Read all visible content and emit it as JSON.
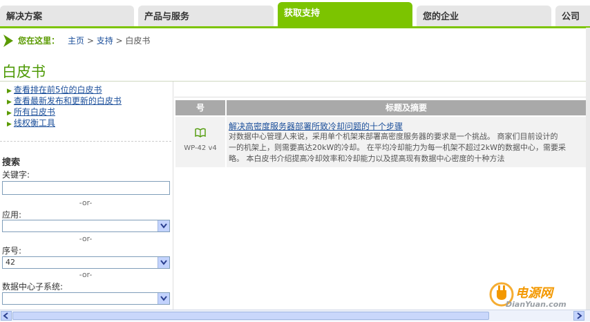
{
  "tabs": [
    {
      "label": "解决方案",
      "active": false
    },
    {
      "label": "产品与服务",
      "active": false
    },
    {
      "label": "获取支持",
      "active": true
    },
    {
      "label": "您的企业",
      "active": false
    },
    {
      "label": "公司",
      "active": false
    }
  ],
  "breadcrumb": {
    "prefix": "您在这里：",
    "home": "主页",
    "sep1": " > ",
    "support": "支持",
    "sep2": " > ",
    "current": "白皮书"
  },
  "page_title": "白皮书",
  "sidebar_links": [
    "查看排在前5位的白皮书",
    "查看最新发布和更新的白皮书",
    "所有白皮书",
    "线权衡工具"
  ],
  "search": {
    "heading": "搜索",
    "keyword_label": "关键字:",
    "or1": "-or-",
    "app_label": "应用:",
    "or2": "-or-",
    "number_label": "序号:",
    "number_value": "42",
    "or3": "-or-",
    "subsystem_label": "数据中心子系统:"
  },
  "table": {
    "col_number": "号",
    "col_title": "标题及摘要",
    "row": {
      "id": "WP-42 v4",
      "title": "解决高密度服务器部署所致冷却问题的十个步骤",
      "desc1": "对数据中心管理人来说，采用单个机架来部署高密度服务器的要求是一个挑战。 商家们目前设计的",
      "desc2": "一的机架上，则需要高达20kW的冷却。 在平均冷却能力为每一机架不超过2kW的数据中心，需要采",
      "desc3": "略。 本白皮书介绍提高冷却效率和冷却能力以及提高现有数据中心密度的十种方法"
    }
  },
  "watermark": {
    "name": "电源网",
    "url": "DianYuan.com"
  },
  "colors": {
    "accent": "#7cc400",
    "title": "#4e9a06",
    "link": "#1a4e9a"
  }
}
